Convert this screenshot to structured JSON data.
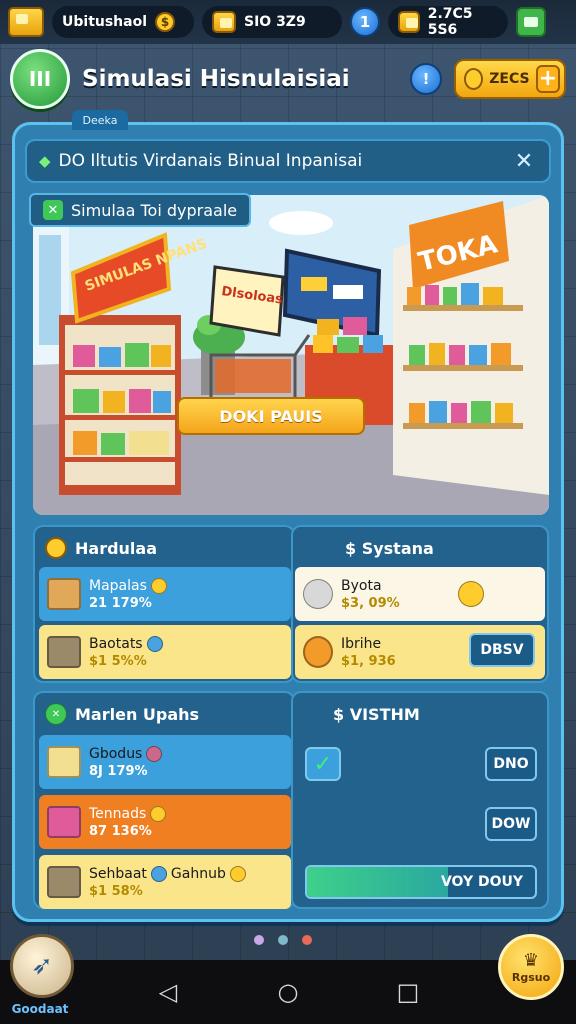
{
  "topbar": {
    "player_name": "Ubitushaol",
    "player_coin_glyph": "$",
    "resource_1": "SIO 3Z9",
    "level_badge": "1",
    "resource_2": "2.7C5 5S6"
  },
  "header": {
    "logo_text": "III",
    "title": "Simulasi Hisnulaisiai",
    "info_glyph": "!",
    "coin_value": "ZECS",
    "plus_glyph": "+"
  },
  "panel": {
    "tag": "Deeka",
    "title": "DO Iltutis Virdanais Binual Inpanisai",
    "close_glyph": "✕",
    "scene_label": "Simulaa Toi dypraale",
    "scene_button": "DOKI PAUIS",
    "shelf_sign_left": "SIMULAS NPANS",
    "shelf_sign_right": "TOKA",
    "board_sign": "Dlsoloas"
  },
  "cards": {
    "hardware": {
      "title": "Hardulaa",
      "rows": [
        {
          "name": "Mapalas",
          "value": "21 179%"
        },
        {
          "name": "Baotats",
          "value": "$1 5%%"
        }
      ]
    },
    "systems": {
      "title": "$ Systana",
      "rows": [
        {
          "name": "Byota",
          "value": "$3, 09%"
        },
        {
          "name": "Ibrihe",
          "value": "$1, 936"
        }
      ],
      "button": "DBSV"
    },
    "market": {
      "title": "Marlen Upahs",
      "rows": [
        {
          "name": "Gbodus",
          "value": "8J 179%"
        },
        {
          "name": "Tennads",
          "value": "87 136%"
        },
        {
          "name": "Sehbaat",
          "extra": "Gahnub",
          "value": "$1 58%"
        }
      ]
    },
    "vsystem": {
      "title": "$ VISTHM",
      "button_1": "DNO",
      "button_2": "DOW",
      "progress_label": "VOY DOUY",
      "progress_fraction": 0.62
    }
  },
  "bottom": {
    "left_label": "Goodaat",
    "right_label": "Rgsuo"
  },
  "colors": {
    "panel": "#2f7fb0",
    "accent": "#5bc1ef",
    "gold": "#f4a41b",
    "green": "#3ec857"
  }
}
